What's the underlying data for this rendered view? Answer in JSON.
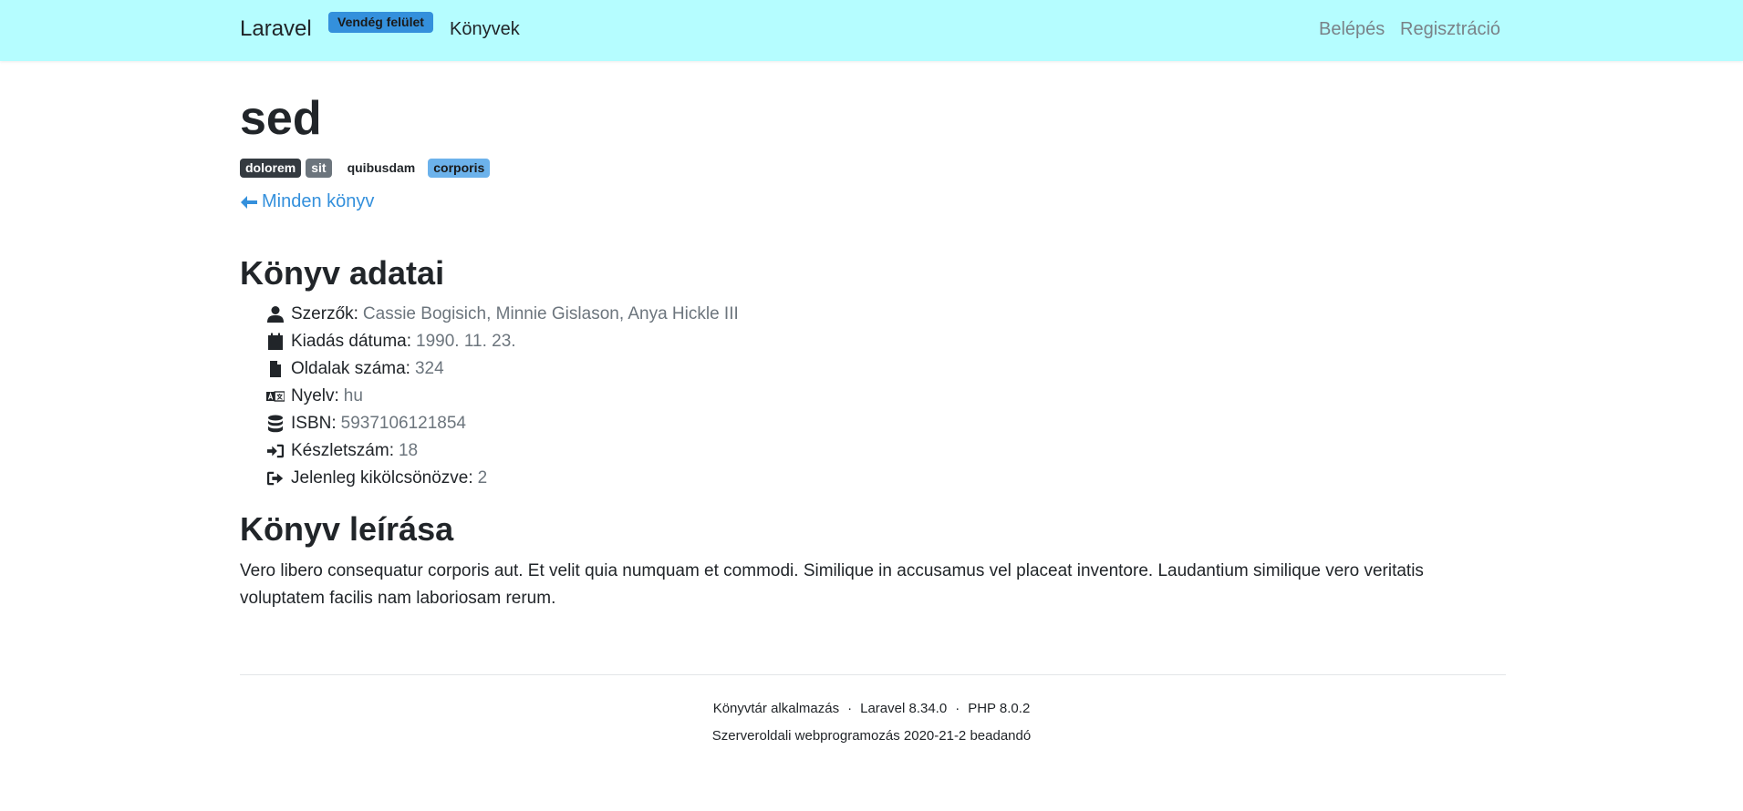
{
  "navbar": {
    "brand": "Laravel",
    "badge": "Vendég felület",
    "books_link": "Könyvek",
    "login": "Belépés",
    "register": "Regisztráció"
  },
  "book": {
    "title": "sed",
    "tags": [
      "dolorem",
      "sit",
      "quibusdam",
      "corporis"
    ],
    "back_link": "Minden könyv"
  },
  "details": {
    "heading": "Könyv adatai",
    "items": [
      {
        "icon": "user-icon",
        "label": "Szerzők:",
        "value": "Cassie Bogisich, Minnie Gislason, Anya Hickle III"
      },
      {
        "icon": "calendar-icon",
        "label": "Kiadás dátuma:",
        "value": "1990. 11. 23."
      },
      {
        "icon": "file-icon",
        "label": "Oldalak száma:",
        "value": "324"
      },
      {
        "icon": "language-icon",
        "label": "Nyelv:",
        "value": "hu"
      },
      {
        "icon": "database-icon",
        "label": "ISBN:",
        "value": "5937106121854"
      },
      {
        "icon": "sign-in-icon",
        "label": "Készletszám:",
        "value": "18"
      },
      {
        "icon": "sign-out-icon",
        "label": "Jelenleg kikölcsönözve:",
        "value": "2"
      }
    ]
  },
  "description": {
    "heading": "Könyv leírása",
    "text": "Vero libero consequatur corporis aut. Et velit quia numquam et commodi. Similique in accusamus vel placeat inventore. Laudantium similique vero veritatis voluptatem facilis nam laboriosam rerum."
  },
  "footer": {
    "app": "Könyvtár alkalmazás",
    "laravel": "Laravel 8.34.0",
    "php": "PHP 8.0.2",
    "separator": "·",
    "course": "Szerveroldali webprogramozás 2020-21-2 beadandó"
  },
  "colors": {
    "navbar_bg": "#b5fdff",
    "primary": "#3490dc",
    "muted": "#6c757d"
  }
}
